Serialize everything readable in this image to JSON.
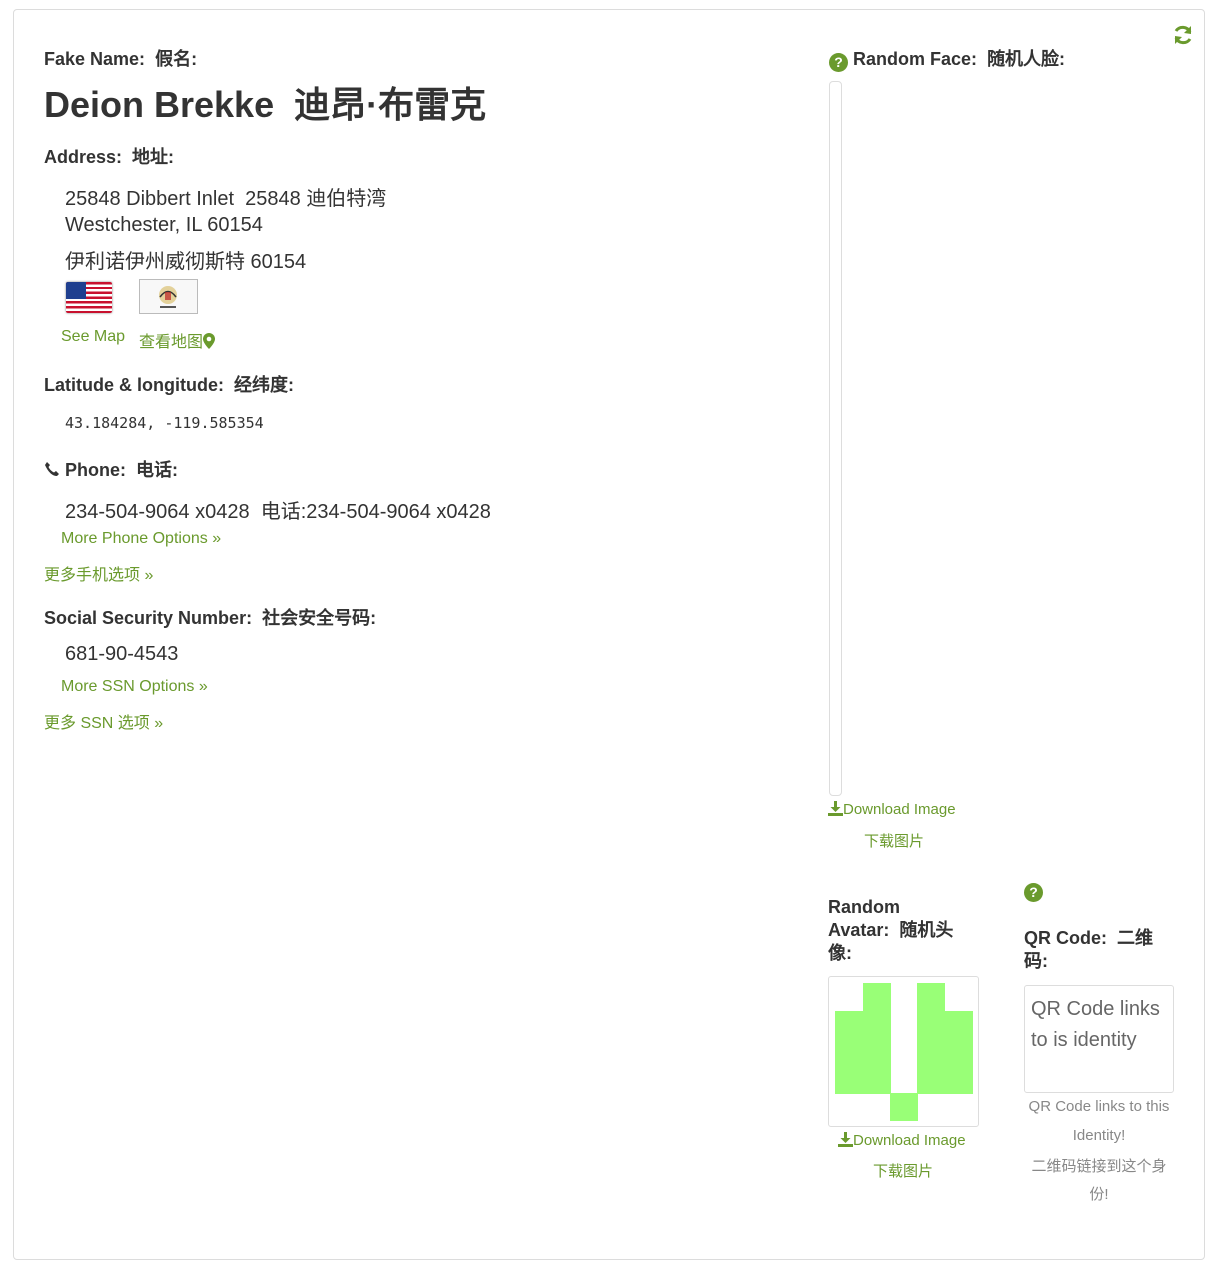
{
  "refresh_icon": "refresh-icon",
  "name": {
    "label": "Fake Name:",
    "label_cn": "假名:",
    "value": "Deion Brekke",
    "value_cn": "迪昂·布雷克"
  },
  "address": {
    "label": "Address:",
    "label_cn": "地址:",
    "line1": "25848 Dibbert Inlet",
    "line1_cn": "25848 迪伯特湾",
    "line2": "Westchester, IL 60154",
    "line3_cn": "伊利诺伊州威彻斯特 60154",
    "see_map": "See Map",
    "see_map_cn": "查看地图",
    "map_icon": "map-marker-icon"
  },
  "latlng": {
    "label": "Latitude & longitude:",
    "label_cn": "经纬度:",
    "value": "43.184284, -119.585354"
  },
  "phone": {
    "icon": "phone-icon",
    "label": "Phone:",
    "label_cn": "电话:",
    "value": "234-504-9064 x0428",
    "value_cn": "电话:234-504-9064 x0428",
    "more": "More Phone Options »",
    "more_cn": "更多手机选项 »"
  },
  "ssn": {
    "label": "Social Security Number:",
    "label_cn": "社会安全号码:",
    "value": "681-90-4543",
    "more": "More SSN Options »",
    "more_cn": "更多 SSN 选项 »"
  },
  "face": {
    "label": "Random Face:",
    "label_cn": "随机人脸:",
    "download": "Download Image",
    "download_cn": "下载图片"
  },
  "avatar": {
    "label_line1": "Random",
    "label_line2": "Avatar:",
    "label_cn_part": "随机头",
    "label_cn_line3": "像:",
    "download": "Download Image",
    "download_cn": "下载图片",
    "color": "#99ff77"
  },
  "qr": {
    "label": "QR Code:",
    "label_cn_part": "二维",
    "label_cn_line2": "码:",
    "alt_text": "QR Code links to is identity",
    "caption1": "QR Code links to this",
    "caption2": "Identity!",
    "caption_cn1": "二维码链接到这个身",
    "caption_cn2": "份!"
  },
  "colors": {
    "accent": "#6a9a2d",
    "text": "#333333",
    "border": "#dcdcdc"
  }
}
